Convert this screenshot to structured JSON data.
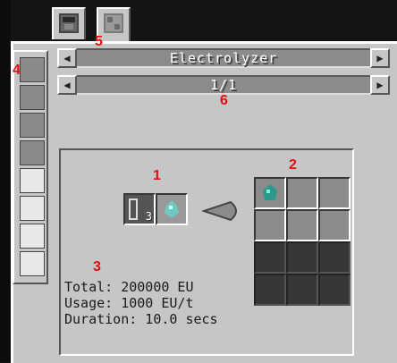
{
  "tabs": [
    {
      "icon": "electrolyzer-block-icon"
    },
    {
      "icon": "machine-casing-icon"
    }
  ],
  "nav": {
    "title": "Electrolyzer",
    "page": "1/1",
    "prev_glyph": "◀",
    "next_glyph": "▶"
  },
  "sidebar": {
    "items": [
      "machine-block-icon",
      "machine-block-icon",
      "machine-block-icon",
      "machine-block-icon",
      "white-block-icon",
      "white-block-icon",
      "white-block-icon",
      "white-block-icon"
    ]
  },
  "recipe": {
    "input_slot_1": {
      "icon": "cell-icon",
      "count": "3"
    },
    "input_slot_2": {
      "icon": "ender-pearl-dust-icon"
    },
    "output_grid_first": {
      "icon": "emerald-dust-icon"
    },
    "arrow": "progress-arrow-icon",
    "info": [
      "Total: 200000 EU",
      "Usage: 1000 EU/t",
      "Duration: 10.0 secs"
    ]
  },
  "annotations": [
    "1",
    "2",
    "3",
    "4",
    "5",
    "6"
  ],
  "colors": {
    "marker": "#e01010",
    "panel": "#c6c6c6",
    "slot": "#8b8b8b"
  }
}
